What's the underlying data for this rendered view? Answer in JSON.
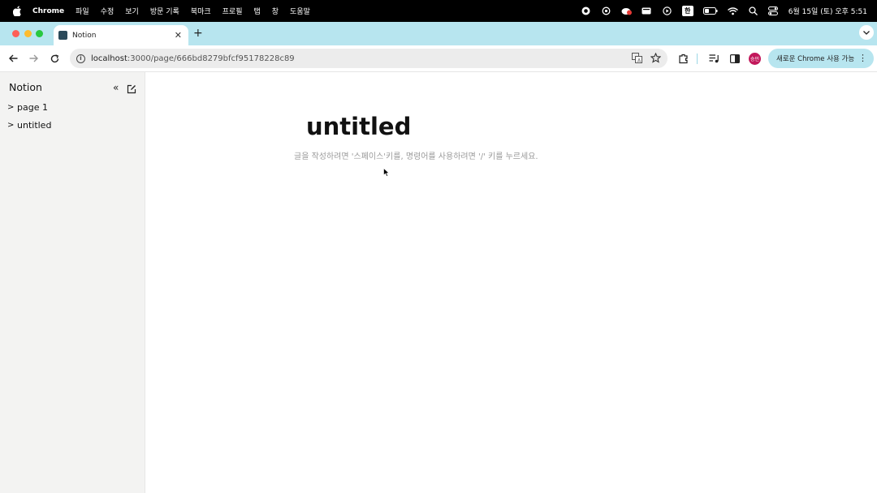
{
  "menubar": {
    "app_name": "Chrome",
    "items": [
      "파일",
      "수정",
      "보기",
      "방문 기록",
      "북마크",
      "프로필",
      "탭",
      "창",
      "도움말"
    ],
    "clock": "6월 15일 (토) 오후 5:51",
    "input_indicator": "한"
  },
  "browser": {
    "tab_title": "Notion",
    "url_host": "localhost",
    "url_path": ":3000/page/666bd8279bfcf95178228c89",
    "update_label": "새로운 Chrome 사용 가능",
    "profile_initials": "승민",
    "colors": {
      "tabstrip": "#b7e5ef",
      "avatar": "#c2185b"
    }
  },
  "sidebar": {
    "brand": "Notion",
    "pages": [
      {
        "label": "page 1"
      },
      {
        "label": "untitled"
      }
    ]
  },
  "editor": {
    "title": "untitled",
    "placeholder": "글을 작성하려면 '스페이스'키를, 명령어를 사용하려면 '/' 키를 누르세요."
  }
}
